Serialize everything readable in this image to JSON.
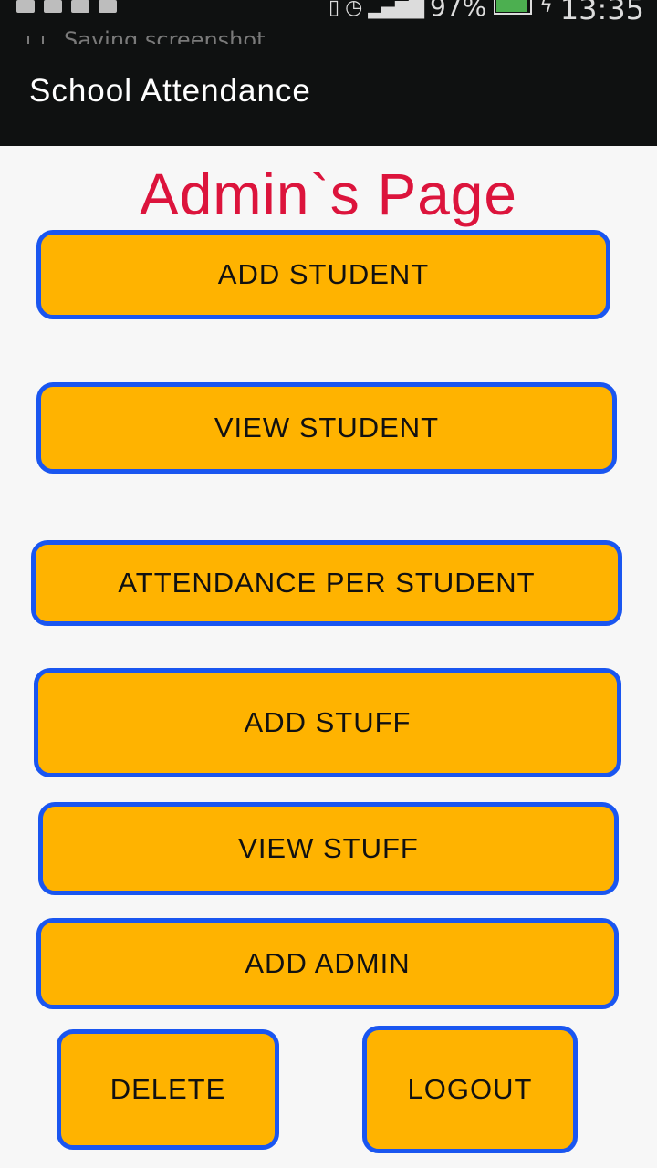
{
  "status_bar": {
    "notification_text": "Saving screenshot...",
    "battery": "97%",
    "time": "13:35",
    "icons": [
      "gallery-icon",
      "android-icon",
      "missed-call-icon",
      "email-icon",
      "vibrate-icon",
      "alarm-icon",
      "signal-icon",
      "battery-icon",
      "charging-icon"
    ]
  },
  "app_bar": {
    "title": "School Attendance"
  },
  "page": {
    "heading": "Admin`s Page",
    "buttons": {
      "add_student": "ADD STUDENT",
      "view_student": "VIEW STUDENT",
      "attendance_per_student": "ATTENDANCE PER STUDENT",
      "add_stuff": "ADD STUFF",
      "view_stuff": "VIEW STUFF",
      "add_admin": "ADD ADMIN",
      "delete": "DELETE",
      "logout": "LOGOUT"
    }
  },
  "colors": {
    "bar_background": "#0f1111",
    "heading": "#dc143c",
    "button_fill": "#ffb300",
    "button_border": "#1a56f0",
    "page_background": "#f7f7f7"
  }
}
